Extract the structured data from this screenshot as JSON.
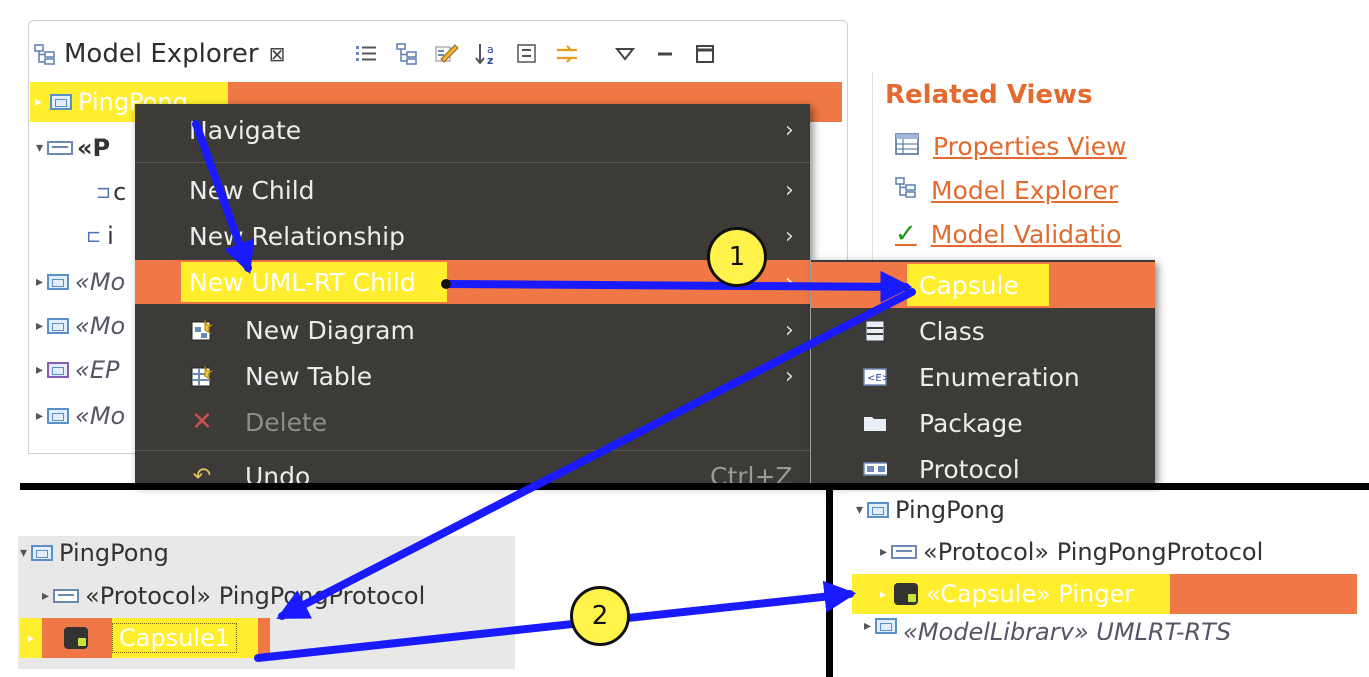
{
  "explorer": {
    "tab_title": "Model Explorer",
    "tab_close": "⊠",
    "tree": {
      "root": "PingPong",
      "child_protocol_stub": "«P",
      "child_c_stub": "c",
      "child_i_stub": "i",
      "row_m1": "«Mo",
      "row_m2": "«Mo",
      "row_ep": "«EP",
      "row_m3": "«Mo"
    }
  },
  "related": {
    "title": "Related Views",
    "links": [
      "Properties View",
      "Model Explorer",
      "Model Validatio"
    ]
  },
  "context_menu": {
    "items": [
      {
        "label": "Navigate",
        "submenu": true
      },
      {
        "label": "New Child",
        "submenu": true
      },
      {
        "label": "New Relationship",
        "submenu": true
      },
      {
        "label": "New UML-RT Child",
        "submenu": true,
        "active": true
      },
      {
        "label": "New Diagram",
        "submenu": true
      },
      {
        "label": "New Table",
        "submenu": true
      },
      {
        "label": "Delete",
        "disabled": true
      },
      {
        "label": "Undo",
        "shortcut": "Ctrl+Z"
      }
    ],
    "submenu_arrow": "›"
  },
  "submenu": {
    "items": [
      "Capsule",
      "Class",
      "Enumeration",
      "Package",
      "Protocol"
    ]
  },
  "bottom_left": {
    "root": "PingPong",
    "protocol": "«Protocol» PingPongProtocol",
    "capsule": "Capsule1"
  },
  "bottom_right": {
    "root": "PingPong",
    "protocol": "«Protocol» PingPongProtocol",
    "capsule": "«Capsule» Pinger",
    "truncated": "«ModelLibrary» UMLRT-RTS"
  },
  "badges": [
    "1",
    "2"
  ],
  "colors": {
    "selection": "#f07746",
    "menu_bg": "#3c3b37",
    "highlight": "#ffee2e",
    "arrow": "#1a1aff",
    "link": "#e36a2e"
  }
}
